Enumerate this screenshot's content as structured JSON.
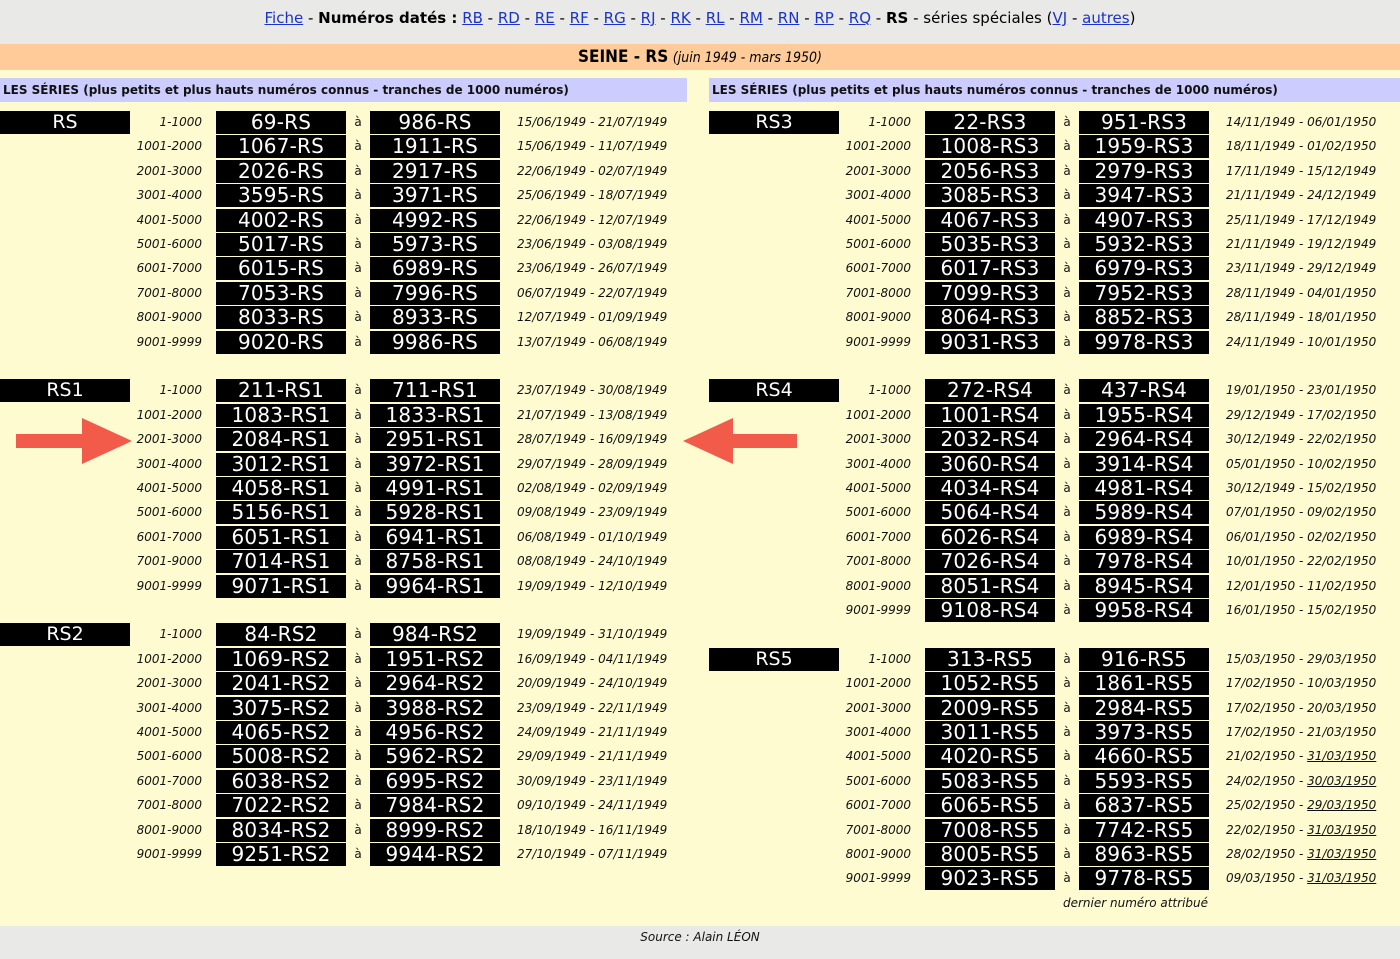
{
  "nav": {
    "fiche": "Fiche",
    "sep": "-",
    "dated_label": "Numéros datés :",
    "dated_links": [
      "RB",
      "RD",
      "RE",
      "RF",
      "RG",
      "RJ",
      "RK",
      "RL",
      "RM",
      "RN",
      "RP",
      "RQ"
    ],
    "current": "RS",
    "special_label": "séries spéciales (",
    "special_links": [
      "VJ",
      "autres"
    ],
    "special_close": ")"
  },
  "banner": {
    "title": "SEINE - RS",
    "period": "(juin 1949 - mars 1950)"
  },
  "column_header": "LES SÉRIES (plus petits et plus hauts numéros connus - tranches de 1000 numéros)",
  "a_word": "à",
  "left_series": [
    {
      "name": "RS",
      "rows": [
        [
          "1-1000",
          "69-RS",
          "986-RS",
          "15/06/1949 - 21/07/1949"
        ],
        [
          "1001-2000",
          "1067-RS",
          "1911-RS",
          "15/06/1949 - 11/07/1949"
        ],
        [
          "2001-3000",
          "2026-RS",
          "2917-RS",
          "22/06/1949 - 02/07/1949"
        ],
        [
          "3001-4000",
          "3595-RS",
          "3971-RS",
          "25/06/1949 - 18/07/1949"
        ],
        [
          "4001-5000",
          "4002-RS",
          "4992-RS",
          "22/06/1949 - 12/07/1949"
        ],
        [
          "5001-6000",
          "5017-RS",
          "5973-RS",
          "23/06/1949 - 03/08/1949"
        ],
        [
          "6001-7000",
          "6015-RS",
          "6989-RS",
          "23/06/1949 - 26/07/1949"
        ],
        [
          "7001-8000",
          "7053-RS",
          "7996-RS",
          "06/07/1949 - 22/07/1949"
        ],
        [
          "8001-9000",
          "8033-RS",
          "8933-RS",
          "12/07/1949 - 01/09/1949"
        ],
        [
          "9001-9999",
          "9020-RS",
          "9986-RS",
          "13/07/1949 - 06/08/1949"
        ]
      ]
    },
    {
      "name": "RS1",
      "rows": [
        [
          "1-1000",
          "211-RS1",
          "711-RS1",
          "23/07/1949 - 30/08/1949"
        ],
        [
          "1001-2000",
          "1083-RS1",
          "1833-RS1",
          "21/07/1949 - 13/08/1949"
        ],
        [
          "2001-3000",
          "2084-RS1",
          "2951-RS1",
          "28/07/1949 - 16/09/1949"
        ],
        [
          "3001-4000",
          "3012-RS1",
          "3972-RS1",
          "29/07/1949 - 28/09/1949"
        ],
        [
          "4001-5000",
          "4058-RS1",
          "4991-RS1",
          "02/08/1949 - 02/09/1949"
        ],
        [
          "5001-6000",
          "5156-RS1",
          "5928-RS1",
          "09/08/1949 - 23/09/1949"
        ],
        [
          "6001-7000",
          "6051-RS1",
          "6941-RS1",
          "06/08/1949 - 01/10/1949"
        ],
        [
          "7001-9000",
          "7014-RS1",
          "8758-RS1",
          "08/08/1949 - 24/10/1949"
        ],
        [
          "9001-9999",
          "9071-RS1",
          "9964-RS1",
          "19/09/1949 - 12/10/1949"
        ]
      ]
    },
    {
      "name": "RS2",
      "rows": [
        [
          "1-1000",
          "84-RS2",
          "984-RS2",
          "19/09/1949 - 31/10/1949"
        ],
        [
          "1001-2000",
          "1069-RS2",
          "1951-RS2",
          "16/09/1949 - 04/11/1949"
        ],
        [
          "2001-3000",
          "2041-RS2",
          "2964-RS2",
          "20/09/1949 - 24/10/1949"
        ],
        [
          "3001-4000",
          "3075-RS2",
          "3988-RS2",
          "23/09/1949 - 22/11/1949"
        ],
        [
          "4001-5000",
          "4065-RS2",
          "4956-RS2",
          "24/09/1949 - 21/11/1949"
        ],
        [
          "5001-6000",
          "5008-RS2",
          "5962-RS2",
          "29/09/1949 - 21/11/1949"
        ],
        [
          "6001-7000",
          "6038-RS2",
          "6995-RS2",
          "30/09/1949 - 23/11/1949"
        ],
        [
          "7001-8000",
          "7022-RS2",
          "7984-RS2",
          "09/10/1949 - 24/11/1949"
        ],
        [
          "8001-9000",
          "8034-RS2",
          "8999-RS2",
          "18/10/1949 - 16/11/1949"
        ],
        [
          "9001-9999",
          "9251-RS2",
          "9944-RS2",
          "27/10/1949 - 07/11/1949"
        ]
      ]
    }
  ],
  "right_series": [
    {
      "name": "RS3",
      "rows": [
        [
          "1-1000",
          "22-RS3",
          "951-RS3",
          "14/11/1949 - 06/01/1950"
        ],
        [
          "1001-2000",
          "1008-RS3",
          "1959-RS3",
          "18/11/1949 - 01/02/1950"
        ],
        [
          "2001-3000",
          "2056-RS3",
          "2979-RS3",
          "17/11/1949 - 15/12/1949"
        ],
        [
          "3001-4000",
          "3085-RS3",
          "3947-RS3",
          "21/11/1949 - 24/12/1949"
        ],
        [
          "4001-5000",
          "4067-RS3",
          "4907-RS3",
          "25/11/1949 - 17/12/1949"
        ],
        [
          "5001-6000",
          "5035-RS3",
          "5932-RS3",
          "21/11/1949 - 19/12/1949"
        ],
        [
          "6001-7000",
          "6017-RS3",
          "6979-RS3",
          "23/11/1949 - 29/12/1949"
        ],
        [
          "7001-8000",
          "7099-RS3",
          "7952-RS3",
          "28/11/1949 - 04/01/1950"
        ],
        [
          "8001-9000",
          "8064-RS3",
          "8852-RS3",
          "28/11/1949 - 18/01/1950"
        ],
        [
          "9001-9999",
          "9031-RS3",
          "9978-RS3",
          "24/11/1949 - 10/01/1950"
        ]
      ]
    },
    {
      "name": "RS4",
      "rows": [
        [
          "1-1000",
          "272-RS4",
          "437-RS4",
          "19/01/1950 - 23/01/1950"
        ],
        [
          "1001-2000",
          "1001-RS4",
          "1955-RS4",
          "29/12/1949 - 17/02/1950"
        ],
        [
          "2001-3000",
          "2032-RS4",
          "2964-RS4",
          "30/12/1949 - 22/02/1950"
        ],
        [
          "3001-4000",
          "3060-RS4",
          "3914-RS4",
          "05/01/1950 - 10/02/1950"
        ],
        [
          "4001-5000",
          "4034-RS4",
          "4981-RS4",
          "30/12/1949 - 15/02/1950"
        ],
        [
          "5001-6000",
          "5064-RS4",
          "5989-RS4",
          "07/01/1950 - 09/02/1950"
        ],
        [
          "6001-7000",
          "6026-RS4",
          "6989-RS4",
          "06/01/1950 - 02/02/1950"
        ],
        [
          "7001-8000",
          "7026-RS4",
          "7978-RS4",
          "10/01/1950 - 22/02/1950"
        ],
        [
          "8001-9000",
          "8051-RS4",
          "8945-RS4",
          "12/01/1950 - 11/02/1950"
        ],
        [
          "9001-9999",
          "9108-RS4",
          "9958-RS4",
          "16/01/1950 - 15/02/1950"
        ]
      ]
    },
    {
      "name": "RS5",
      "rows": [
        [
          "1-1000",
          "313-RS5",
          "916-RS5",
          "15/03/1950 - 29/03/1950"
        ],
        [
          "1001-2000",
          "1052-RS5",
          "1861-RS5",
          "17/02/1950 - 10/03/1950"
        ],
        [
          "2001-3000",
          "2009-RS5",
          "2984-RS5",
          "17/02/1950 - 20/03/1950"
        ],
        [
          "3001-4000",
          "3011-RS5",
          "3973-RS5",
          "17/02/1950 - 21/03/1950"
        ],
        [
          "4001-5000",
          "4020-RS5",
          "4660-RS5",
          "21/02/1950 - ",
          "31/03/1950"
        ],
        [
          "5001-6000",
          "5083-RS5",
          "5593-RS5",
          "24/02/1950 - ",
          "30/03/1950"
        ],
        [
          "6001-7000",
          "6065-RS5",
          "6837-RS5",
          "25/02/1950 - ",
          "29/03/1950"
        ],
        [
          "7001-8000",
          "7008-RS5",
          "7742-RS5",
          "22/02/1950 - ",
          "31/03/1950"
        ],
        [
          "8001-9000",
          "8005-RS5",
          "8963-RS5",
          "28/02/1950 - ",
          "31/03/1950"
        ],
        [
          "9001-9999",
          "9023-RS5",
          "9778-RS5",
          "09/03/1950 - ",
          "31/03/1950"
        ]
      ]
    }
  ],
  "note": "dernier numéro attribué",
  "source": "Source : Alain LÉON",
  "colors": {
    "panel": "#fffbd0",
    "banner": "#ffcc99",
    "header": "#ccccff",
    "arrow": "#f25a4a",
    "link": "#1a33cc"
  }
}
